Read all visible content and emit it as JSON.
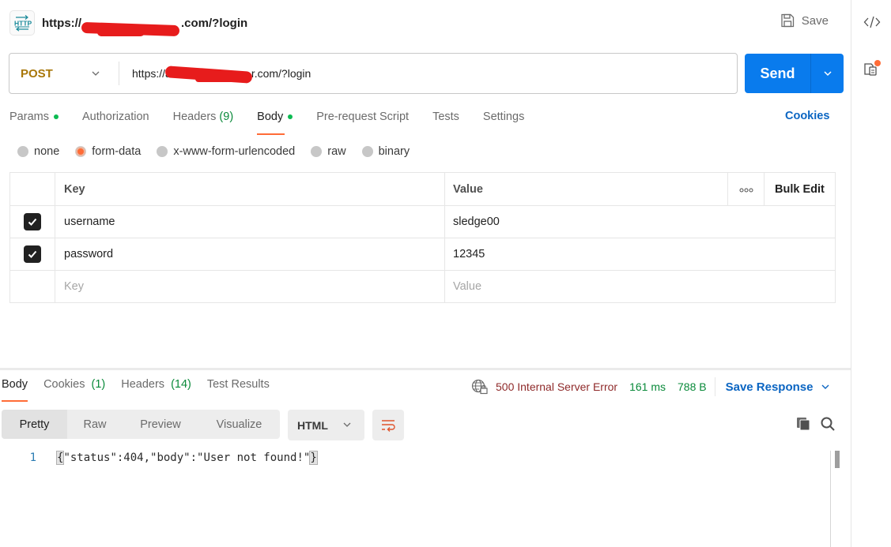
{
  "header": {
    "icon": "http-icon",
    "title_prefix": "https://",
    "title_suffix": ".com/?login",
    "save_label": "Save"
  },
  "request": {
    "method": "POST",
    "url_prefix": "https://a",
    "url_suffix": "r.com/?login",
    "send_label": "Send"
  },
  "tabs": [
    {
      "label": "Params",
      "dot": true
    },
    {
      "label": "Authorization"
    },
    {
      "label": "Headers",
      "count": "(9)"
    },
    {
      "label": "Body",
      "dot": true,
      "active": true
    },
    {
      "label": "Pre-request Script"
    },
    {
      "label": "Tests"
    },
    {
      "label": "Settings"
    }
  ],
  "cookies_link": "Cookies",
  "body_types": [
    {
      "label": "none",
      "selected": false
    },
    {
      "label": "form-data",
      "selected": true
    },
    {
      "label": "x-www-form-urlencoded",
      "selected": false
    },
    {
      "label": "raw",
      "selected": false
    },
    {
      "label": "binary",
      "selected": false
    }
  ],
  "form_table": {
    "headers": {
      "key": "Key",
      "value": "Value",
      "more": "ooo",
      "bulk_edit": "Bulk Edit"
    },
    "rows": [
      {
        "checked": true,
        "key": "username",
        "value": "sledge00"
      },
      {
        "checked": true,
        "key": "password",
        "value": "12345"
      }
    ],
    "placeholder_key": "Key",
    "placeholder_value": "Value"
  },
  "response": {
    "tabs": [
      {
        "label": "Body",
        "active": true
      },
      {
        "label": "Cookies",
        "count": "(1)"
      },
      {
        "label": "Headers",
        "count": "(14)"
      },
      {
        "label": "Test Results"
      }
    ],
    "status": "500 Internal Server Error",
    "time": "161 ms",
    "size": "788 B",
    "save_response": "Save Response",
    "formats": [
      "Pretty",
      "Raw",
      "Preview",
      "Visualize"
    ],
    "selected_format": "Pretty",
    "language": "HTML",
    "lines": [
      {
        "no": "1",
        "open": "{",
        "text": "\"status\":404,\"body\":\"User not found!\"",
        "close": "}"
      }
    ]
  },
  "colors": {
    "accent": "#ff6c37",
    "send": "#097bed",
    "link": "#0b65c2",
    "method_post": "#a8770a",
    "success": "#0a8a3a",
    "error": "#8f2a2a"
  }
}
